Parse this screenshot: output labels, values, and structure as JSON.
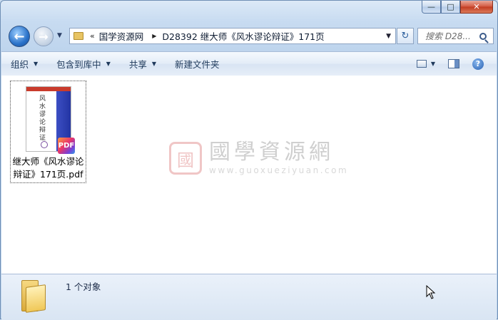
{
  "window": {
    "minimize_glyph": "—",
    "maximize_glyph": "□",
    "close_glyph": "✕"
  },
  "nav": {
    "back_glyph": "←",
    "forward_glyph": "→",
    "history_glyph": "▼"
  },
  "address": {
    "overflow": "«",
    "crumbs": [
      "国学资源网",
      "D28392 继大师《风水谬论辩证》171页"
    ],
    "separator": "▶",
    "dropdown_glyph": "▼",
    "refresh_glyph": "↻"
  },
  "search": {
    "placeholder": "搜索 D28..."
  },
  "toolbar": {
    "organize": "组织",
    "include_library": "包含到库中",
    "share": "共享",
    "new_folder": "新建文件夹",
    "arrow": "▼",
    "help": "?"
  },
  "file": {
    "name": "继大师《风水谬论辩证》171页.pdf",
    "thumb_title": "风水谬论辩证",
    "badge": "PDF"
  },
  "watermark": {
    "logo_char": "國",
    "cn": "國學資源網",
    "url": "www.guoxueziyuan.com"
  },
  "status": {
    "count": "1 个对象"
  },
  "colors": {
    "accent": "#2a72c9",
    "pdf_red": "#c93b2c",
    "watermark_red": "#c52020"
  }
}
